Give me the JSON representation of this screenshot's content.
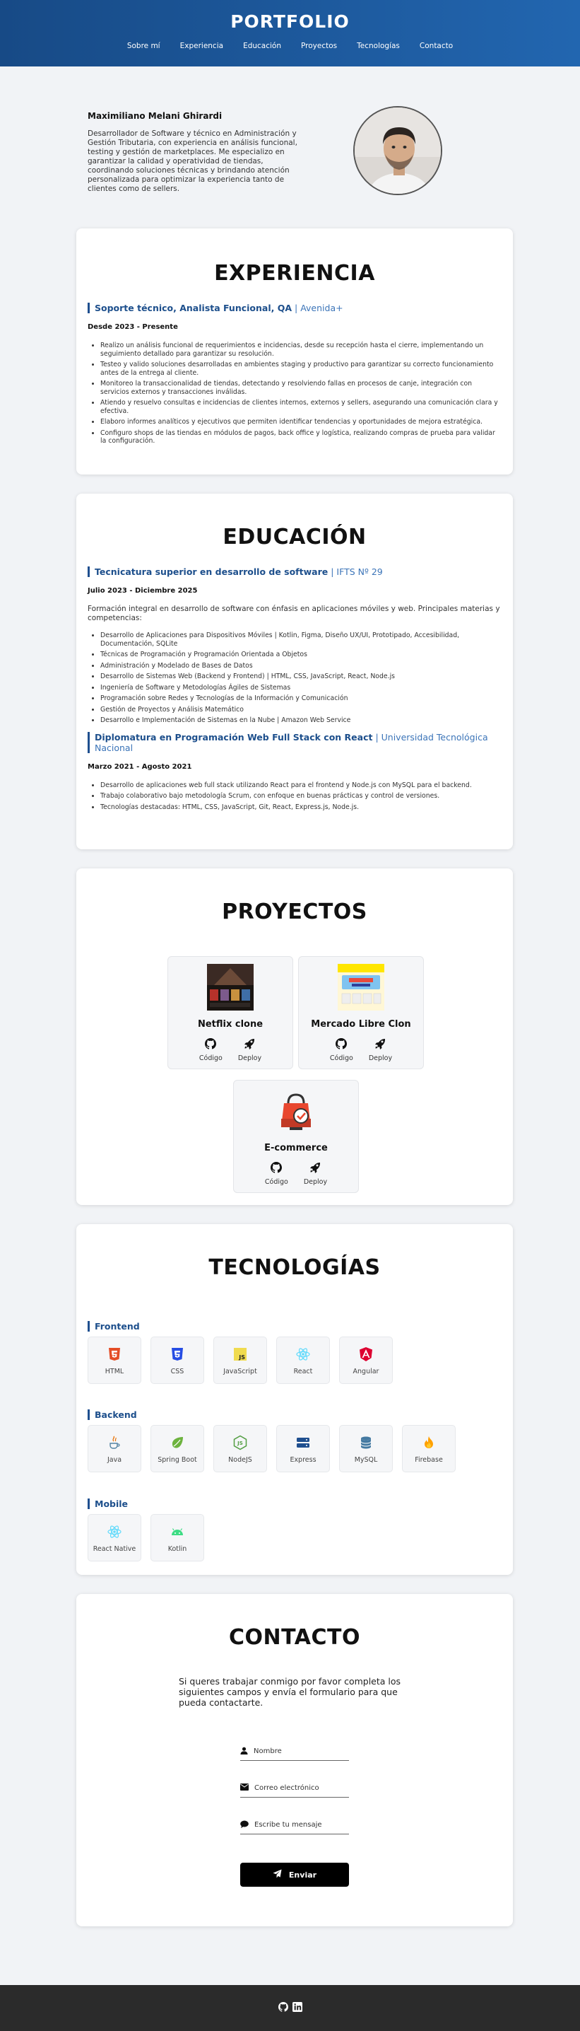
{
  "header": {
    "title": "PORTFOLIO",
    "nav": [
      "Sobre mí",
      "Experiencia",
      "Educación",
      "Proyectos",
      "Tecnologías",
      "Contacto"
    ]
  },
  "about": {
    "name": "Maximiliano Melani Ghirardi",
    "description": "Desarrollador de Software y técnico en Administración y Gestión Tributaria, con experiencia en análisis funcional, testing y gestión de marketplaces. Me especializo en garantizar la calidad y operatividad de tiendas, coordinando soluciones técnicas y brindando atención personalizada para optimizar la experiencia tanto de clientes como de sellers."
  },
  "experience": {
    "heading": "EXPERIENCIA",
    "role": "Soporte técnico, Analista Funcional, QA",
    "separator": " | ",
    "company": "Avenida+",
    "period": "Desde 2023 - Presente",
    "bullets": [
      "Realizo un análisis funcional de requerimientos e incidencias, desde su recepción hasta el cierre, implementando un seguimiento detallado para garantizar su resolución.",
      "Testeo y valido soluciones desarrolladas en ambientes staging y productivo para garantizar su correcto funcionamiento antes de la entrega al cliente.",
      "Monitoreo la transaccionalidad de tiendas, detectando y resolviendo fallas en procesos de canje, integración con servicios externos y transacciones inválidas.",
      "Atiendo y resuelvo consultas e incidencias de clientes internos, externos y sellers, asegurando una comunicación clara y efectiva.",
      "Elaboro informes analíticos y ejecutivos que permiten identificar tendencias y oportunidades de mejora estratégica.",
      "Configuro shops de las tiendas en módulos de pagos, back office y logística, realizando compras de prueba para validar la configuración."
    ]
  },
  "education": {
    "heading": "EDUCACIÓN",
    "items": [
      {
        "title": "Tecnicatura superior en desarrollo de software",
        "institution": "IFTS Nº 29",
        "period": "Julio 2023 - Diciembre 2025",
        "description": "Formación integral en desarrollo de software con énfasis en aplicaciones móviles y web. Principales materias y competencias:",
        "bullets": [
          "Desarrollo de Aplicaciones para Dispositivos Móviles | Kotlin, Figma, Diseño UX/UI, Prototipado, Accesibilidad, Documentación, SQLite",
          "Técnicas de Programación y Programación Orientada a Objetos",
          "Administración y Modelado de Bases de Datos",
          "Desarrollo de Sistemas Web (Backend y Frontend) | HTML, CSS, JavaScript, React, Node.js",
          "Ingeniería de Software y Metodologías Ágiles de Sistemas",
          "Programación sobre Redes y Tecnologías de la Información y Comunicación",
          "Gestión de Proyectos y Análisis Matemático",
          "Desarrollo e Implementación de Sistemas en la Nube | Amazon Web Service"
        ]
      },
      {
        "title": "Diplomatura en Programación Web Full Stack con React",
        "institution": "Universidad Tecnológica Nacional",
        "period": "Marzo 2021 - Agosto 2021",
        "bullets": [
          "Desarrollo de aplicaciones web full stack utilizando React para el frontend y Node.js con MySQL para el backend.",
          "Trabajo colaborativo bajo metodología Scrum, con enfoque en buenas prácticas y control de versiones.",
          "Tecnologías destacadas: HTML, CSS, JavaScript, Git, React, Express.js, Node.js."
        ]
      }
    ]
  },
  "projects": {
    "heading": "PROYECTOS",
    "code_label": "Código",
    "deploy_label": "Deploy",
    "items": [
      {
        "name": "Netflix clone"
      },
      {
        "name": "Mercado Libre Clon"
      },
      {
        "name": "E-commerce"
      }
    ]
  },
  "technologies": {
    "heading": "TECNOLOGÍAS",
    "groups": [
      {
        "name": "Frontend",
        "items": [
          "HTML",
          "CSS",
          "JavaScript",
          "React",
          "Angular"
        ]
      },
      {
        "name": "Backend",
        "items": [
          "Java",
          "Spring Boot",
          "NodeJS",
          "Express",
          "MySQL",
          "Firebase"
        ]
      },
      {
        "name": "Mobile",
        "items": [
          "React Native",
          "Kotlin"
        ]
      }
    ]
  },
  "contact": {
    "heading": "CONTACTO",
    "intro": "Si queres trabajar conmigo por favor completa los siguientes campos y envía el formulario para que pueda contactarte.",
    "name_placeholder": "Nombre",
    "email_placeholder": "Correo electrónico",
    "message_placeholder": "Escribe tu mensaje",
    "submit_label": "Enviar"
  },
  "colors": {
    "header_start": "#174a86",
    "header_end": "#2266b0",
    "accent": "#1d4f8c",
    "footer": "#2b2b2b"
  }
}
